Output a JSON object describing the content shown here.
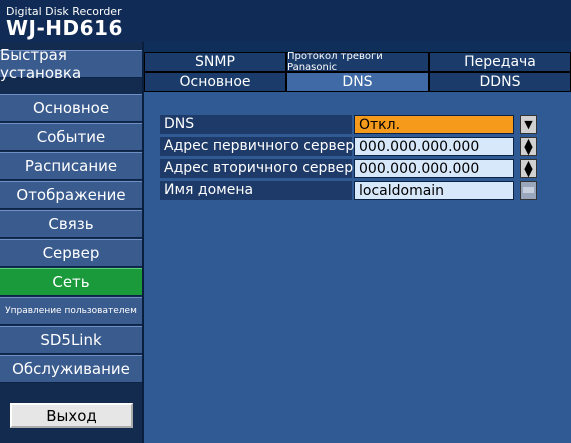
{
  "header": {
    "subtitle": "Digital Disk Recorder",
    "title": "WJ-HD616"
  },
  "sidebar": {
    "quick_setup": "Быстрая установка",
    "items": [
      "Основное",
      "Событие",
      "Расписание",
      "Отображение",
      "Связь",
      "Сервер",
      "Сеть",
      "Управление пользователем",
      "SD5Link",
      "Обслуживание"
    ],
    "active_item": "Сеть",
    "exit": "Выход"
  },
  "tabs": {
    "row1": [
      "SNMP",
      "Протокол тревоги Panasonic",
      "Передача"
    ],
    "row2": [
      "Основное",
      "DNS",
      "DDNS"
    ],
    "active": "DNS"
  },
  "dns_form": {
    "rows": [
      {
        "label": "DNS",
        "value": "Откл."
      },
      {
        "label": "Адрес первичного сервера",
        "value": "000.000.000.000"
      },
      {
        "label": "Адрес вторичного сервера",
        "value": "000.000.000.000"
      },
      {
        "label": "Имя домена",
        "value": "localdomain"
      }
    ]
  },
  "colors": {
    "active_green": "#1a9a3a",
    "dropdown_orange": "#f59a1a",
    "panel_blue": "#305a94"
  }
}
